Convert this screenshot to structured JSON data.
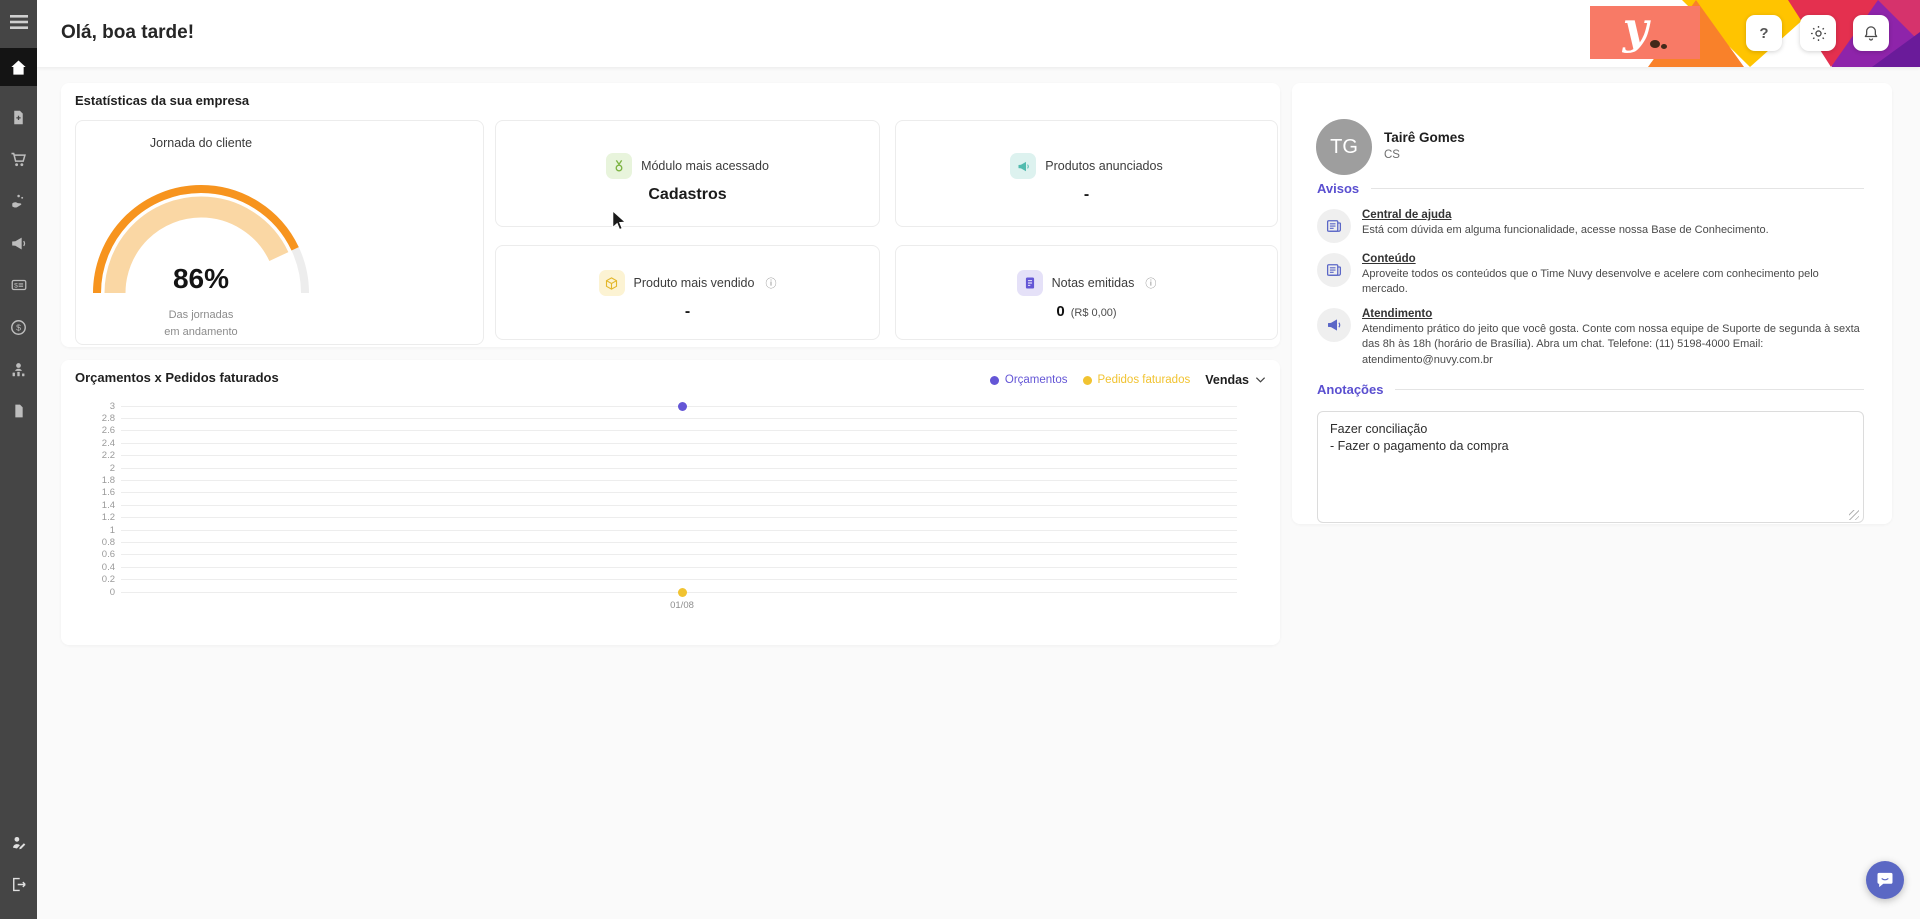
{
  "header": {
    "greeting": "Olá, boa tarde!",
    "help_label": "?",
    "icons": [
      "help-icon",
      "settings-gear-icon",
      "notifications-bell-icon"
    ],
    "logo_text": "y"
  },
  "sidebar": {
    "active": "home",
    "icons": [
      "menu-icon",
      "home-icon",
      "file-plus-icon",
      "cart-icon",
      "hand-coins-icon",
      "megaphone-icon",
      "billing-icon",
      "dollar-circle-icon",
      "customer-stats-icon",
      "file-icon",
      "user-edit-icon",
      "logout-icon"
    ]
  },
  "stats": {
    "section_title": "Estatísticas da sua empresa",
    "journey": {
      "title": "Jornada do cliente",
      "percent": 86,
      "percent_label": "86%",
      "caption_line1": "Das jornadas",
      "caption_line2": "em andamento"
    },
    "cards": [
      {
        "icon": "medal-icon",
        "title": "Módulo mais acessado",
        "value": "Cadastros"
      },
      {
        "icon": "megaphone-icon",
        "title": "Produtos anunciados",
        "value": "-"
      },
      {
        "icon": "package-icon",
        "title": "Produto mais vendido",
        "info": "ⓘ",
        "value": "-"
      },
      {
        "icon": "invoice-icon",
        "title": "Notas emitidas",
        "info": "ⓘ",
        "value": "0",
        "value_note": "(R$ 0,00)"
      }
    ]
  },
  "chart_data": {
    "type": "scatter",
    "title": "Orçamentos x Pedidos faturados",
    "filter_label": "Vendas",
    "x_categories": [
      "01/08"
    ],
    "series": [
      {
        "name": "Orçamentos",
        "color": "#6456D6",
        "values": [
          3
        ]
      },
      {
        "name": "Pedidos faturados",
        "color": "#F1C331",
        "values": [
          0
        ]
      }
    ],
    "ylim": [
      0,
      3
    ],
    "yticks": [
      "3",
      "2.8",
      "2.6",
      "2.4",
      "2.2",
      "2",
      "1.8",
      "1.6",
      "1.4",
      "1.2",
      "1",
      "0.8",
      "0.6",
      "0.4",
      "0.2",
      "0"
    ],
    "grid": true,
    "legend_position": "top-right"
  },
  "profile": {
    "initials": "TG",
    "name": "Tairê Gomes",
    "role": "CS"
  },
  "avisos": {
    "title": "Avisos",
    "items": [
      {
        "icon": "news-icon",
        "title": "Central de ajuda",
        "description": "Está com dúvida em alguma funcionalidade, acesse nossa Base de Conhecimento."
      },
      {
        "icon": "news-icon",
        "title": "Conteúdo",
        "description": "Aproveite todos os conteúdos que o Time Nuvy desenvolve e acelere com conhecimento pelo mercado."
      },
      {
        "icon": "megaphone-icon",
        "title": "Atendimento",
        "description": "Atendimento prático do jeito que você gosta. Conte com nossa equipe de Suporte de segunda à sexta das 8h às 18h (horário de Brasília). Abra um chat. Telefone: (11) 5198-4000 Email: atendimento@nuvy.com.br"
      }
    ]
  },
  "anotacoes": {
    "title": "Anotações",
    "note": "Fazer conciliação\n- Fazer o pagamento da compra"
  },
  "colors": {
    "accent_purple": "#5A4FD0",
    "gauge_orange": "#F7941E",
    "gauge_peach": "#FAD7A4",
    "logo_coral": "#F87A66",
    "chat_indigo": "#5B68C4",
    "sidebar_gray": "#454545"
  }
}
